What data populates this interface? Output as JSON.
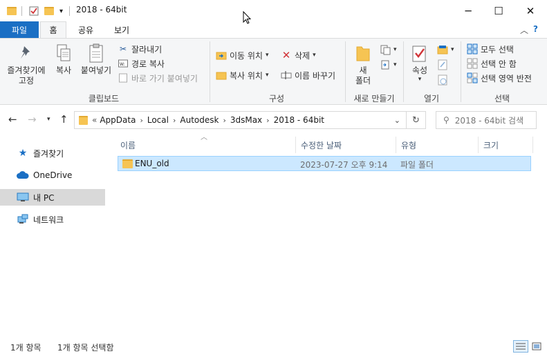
{
  "window": {
    "title": "2018 - 64bit",
    "minimize_icon": "─",
    "maximize_icon": "☐",
    "close_icon": "✕"
  },
  "ribbon": {
    "tabs": [
      "파일",
      "홈",
      "공유",
      "보기"
    ],
    "home": {
      "clipboard": {
        "pin": "즐겨찾기에\n고정",
        "copy": "복사",
        "paste": "붙여넣기",
        "cut": "잘라내기",
        "copy_path": "경로 복사",
        "paste_shortcut": "바로 가기 붙여넣기",
        "group_label": "클립보드"
      },
      "organize": {
        "move_to": "이동 위치",
        "copy_to": "복사 위치",
        "delete": "삭제",
        "rename": "이름 바꾸기",
        "group_label": "구성"
      },
      "new": {
        "new_folder": "새\n폴더",
        "group_label": "새로 만들기"
      },
      "open": {
        "properties": "속성",
        "group_label": "열기"
      },
      "select": {
        "select_all": "모두 선택",
        "select_none": "선택 안 함",
        "invert": "선택 영역 반전",
        "group_label": "선택"
      }
    }
  },
  "address": {
    "segments": [
      "AppData",
      "Local",
      "Autodesk",
      "3dsMax",
      "2018 - 64bit"
    ],
    "overflow": "«",
    "search_placeholder": "2018 - 64bit 검색"
  },
  "sidebar": {
    "items": [
      {
        "label": "즐겨찾기",
        "icon": "star-icon"
      },
      {
        "label": "OneDrive",
        "icon": "cloud-icon"
      },
      {
        "label": "내 PC",
        "icon": "computer-icon"
      },
      {
        "label": "네트워크",
        "icon": "network-icon"
      }
    ]
  },
  "filelist": {
    "columns": [
      "이름",
      "수정한 날짜",
      "유형",
      "크기"
    ],
    "rows": [
      {
        "name": "ENU_old",
        "modified": "2023-07-27 오후 9:14",
        "type": "파일 폴더",
        "size": ""
      }
    ]
  },
  "status": {
    "count": "1개 항목",
    "selected": "1개 항목 선택함"
  }
}
